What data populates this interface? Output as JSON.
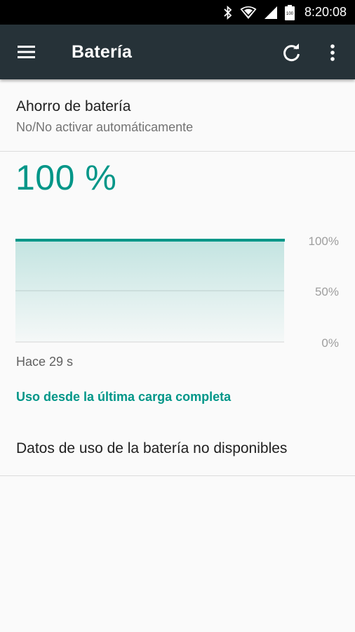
{
  "status_bar": {
    "time": "8:20:08",
    "icons": [
      "bluetooth-icon",
      "wifi-icon",
      "signal-icon",
      "battery-icon"
    ],
    "battery_icon_text": "100"
  },
  "toolbar": {
    "title": "Batería",
    "icons": [
      "menu-icon",
      "refresh-icon",
      "more-vert-icon"
    ]
  },
  "battery_saver": {
    "title": "Ahorro de batería",
    "summary": "No/No activar automáticamente"
  },
  "battery_level": {
    "text": "100 %",
    "value": 100
  },
  "chart": {
    "y_labels": [
      "100%",
      "50%",
      "0%"
    ],
    "level": 100
  },
  "time_ago": "Hace 29 s",
  "usage_link": "Uso desde la última carga completa",
  "no_data": "Datos de uso de la batería no disponibles",
  "colors": {
    "accent": "#009688",
    "toolbar_bg": "#263238",
    "status_bar_bg": "#000000",
    "background": "#fafafa"
  }
}
